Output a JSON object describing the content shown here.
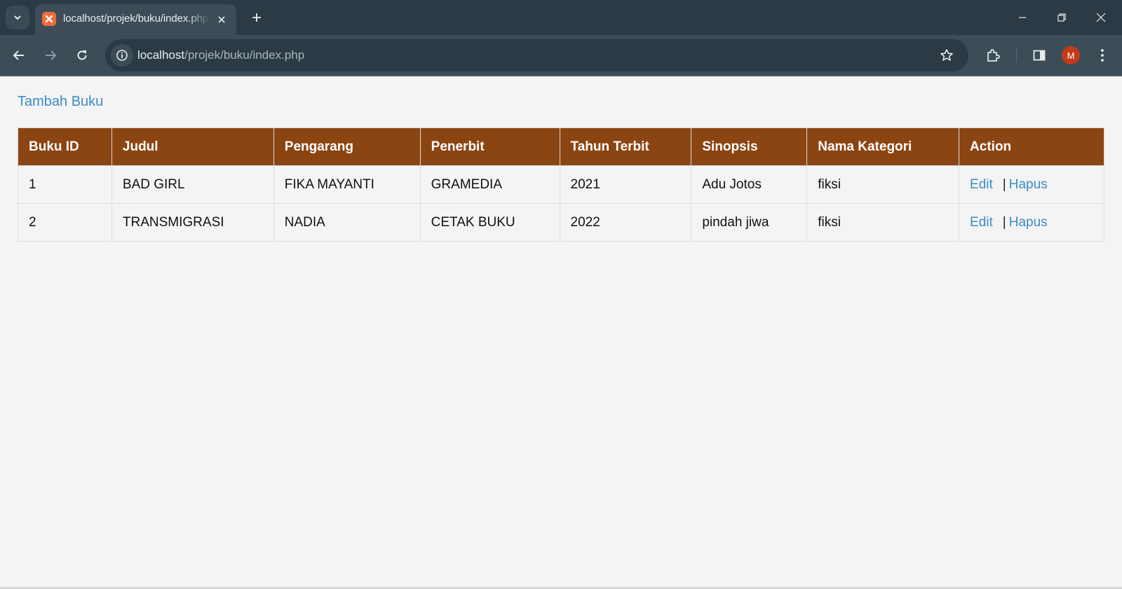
{
  "browser": {
    "tab": {
      "title": "localhost/projek/buku/index.php"
    },
    "address": {
      "host": "localhost",
      "path": "/projek/buku/index.php"
    },
    "profile_initial": "M"
  },
  "page": {
    "add_link": "Tambah Buku",
    "table": {
      "headers": [
        "Buku ID",
        "Judul",
        "Pengarang",
        "Penerbit",
        "Tahun Terbit",
        "Sinopsis",
        "Nama Kategori",
        "Action"
      ],
      "rows": [
        {
          "id": "1",
          "judul": "BAD GIRL",
          "pengarang": "FIKA MAYANTI",
          "penerbit": "GRAMEDIA",
          "tahun": "2021",
          "sinopsis": "Adu Jotos",
          "kategori": "fiksi",
          "edit": "Edit",
          "separator": "|",
          "hapus": "Hapus"
        },
        {
          "id": "2",
          "judul": "TRANSMIGRASI",
          "pengarang": "NADIA",
          "penerbit": "CETAK BUKU",
          "tahun": "2022",
          "sinopsis": "pindah jiwa",
          "kategori": "fiksi",
          "edit": "Edit",
          "separator": "|",
          "hapus": "Hapus"
        }
      ]
    }
  },
  "colors": {
    "table_header": "#8b4513",
    "link": "#3b8cc4",
    "page_background": "#f4f4f4",
    "chrome_toolbar": "#3c4d58",
    "chrome_tabbar": "#2b3a44"
  }
}
